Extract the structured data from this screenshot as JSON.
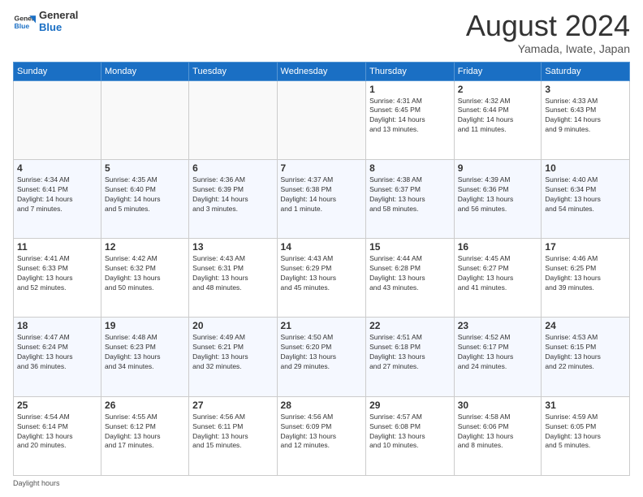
{
  "header": {
    "logo_line1": "General",
    "logo_line2": "Blue",
    "title": "August 2024",
    "location": "Yamada, Iwate, Japan"
  },
  "weekdays": [
    "Sunday",
    "Monday",
    "Tuesday",
    "Wednesday",
    "Thursday",
    "Friday",
    "Saturday"
  ],
  "weeks": [
    [
      {
        "day": "",
        "info": ""
      },
      {
        "day": "",
        "info": ""
      },
      {
        "day": "",
        "info": ""
      },
      {
        "day": "",
        "info": ""
      },
      {
        "day": "1",
        "info": "Sunrise: 4:31 AM\nSunset: 6:45 PM\nDaylight: 14 hours\nand 13 minutes."
      },
      {
        "day": "2",
        "info": "Sunrise: 4:32 AM\nSunset: 6:44 PM\nDaylight: 14 hours\nand 11 minutes."
      },
      {
        "day": "3",
        "info": "Sunrise: 4:33 AM\nSunset: 6:43 PM\nDaylight: 14 hours\nand 9 minutes."
      }
    ],
    [
      {
        "day": "4",
        "info": "Sunrise: 4:34 AM\nSunset: 6:41 PM\nDaylight: 14 hours\nand 7 minutes."
      },
      {
        "day": "5",
        "info": "Sunrise: 4:35 AM\nSunset: 6:40 PM\nDaylight: 14 hours\nand 5 minutes."
      },
      {
        "day": "6",
        "info": "Sunrise: 4:36 AM\nSunset: 6:39 PM\nDaylight: 14 hours\nand 3 minutes."
      },
      {
        "day": "7",
        "info": "Sunrise: 4:37 AM\nSunset: 6:38 PM\nDaylight: 14 hours\nand 1 minute."
      },
      {
        "day": "8",
        "info": "Sunrise: 4:38 AM\nSunset: 6:37 PM\nDaylight: 13 hours\nand 58 minutes."
      },
      {
        "day": "9",
        "info": "Sunrise: 4:39 AM\nSunset: 6:36 PM\nDaylight: 13 hours\nand 56 minutes."
      },
      {
        "day": "10",
        "info": "Sunrise: 4:40 AM\nSunset: 6:34 PM\nDaylight: 13 hours\nand 54 minutes."
      }
    ],
    [
      {
        "day": "11",
        "info": "Sunrise: 4:41 AM\nSunset: 6:33 PM\nDaylight: 13 hours\nand 52 minutes."
      },
      {
        "day": "12",
        "info": "Sunrise: 4:42 AM\nSunset: 6:32 PM\nDaylight: 13 hours\nand 50 minutes."
      },
      {
        "day": "13",
        "info": "Sunrise: 4:43 AM\nSunset: 6:31 PM\nDaylight: 13 hours\nand 48 minutes."
      },
      {
        "day": "14",
        "info": "Sunrise: 4:43 AM\nSunset: 6:29 PM\nDaylight: 13 hours\nand 45 minutes."
      },
      {
        "day": "15",
        "info": "Sunrise: 4:44 AM\nSunset: 6:28 PM\nDaylight: 13 hours\nand 43 minutes."
      },
      {
        "day": "16",
        "info": "Sunrise: 4:45 AM\nSunset: 6:27 PM\nDaylight: 13 hours\nand 41 minutes."
      },
      {
        "day": "17",
        "info": "Sunrise: 4:46 AM\nSunset: 6:25 PM\nDaylight: 13 hours\nand 39 minutes."
      }
    ],
    [
      {
        "day": "18",
        "info": "Sunrise: 4:47 AM\nSunset: 6:24 PM\nDaylight: 13 hours\nand 36 minutes."
      },
      {
        "day": "19",
        "info": "Sunrise: 4:48 AM\nSunset: 6:23 PM\nDaylight: 13 hours\nand 34 minutes."
      },
      {
        "day": "20",
        "info": "Sunrise: 4:49 AM\nSunset: 6:21 PM\nDaylight: 13 hours\nand 32 minutes."
      },
      {
        "day": "21",
        "info": "Sunrise: 4:50 AM\nSunset: 6:20 PM\nDaylight: 13 hours\nand 29 minutes."
      },
      {
        "day": "22",
        "info": "Sunrise: 4:51 AM\nSunset: 6:18 PM\nDaylight: 13 hours\nand 27 minutes."
      },
      {
        "day": "23",
        "info": "Sunrise: 4:52 AM\nSunset: 6:17 PM\nDaylight: 13 hours\nand 24 minutes."
      },
      {
        "day": "24",
        "info": "Sunrise: 4:53 AM\nSunset: 6:15 PM\nDaylight: 13 hours\nand 22 minutes."
      }
    ],
    [
      {
        "day": "25",
        "info": "Sunrise: 4:54 AM\nSunset: 6:14 PM\nDaylight: 13 hours\nand 20 minutes."
      },
      {
        "day": "26",
        "info": "Sunrise: 4:55 AM\nSunset: 6:12 PM\nDaylight: 13 hours\nand 17 minutes."
      },
      {
        "day": "27",
        "info": "Sunrise: 4:56 AM\nSunset: 6:11 PM\nDaylight: 13 hours\nand 15 minutes."
      },
      {
        "day": "28",
        "info": "Sunrise: 4:56 AM\nSunset: 6:09 PM\nDaylight: 13 hours\nand 12 minutes."
      },
      {
        "day": "29",
        "info": "Sunrise: 4:57 AM\nSunset: 6:08 PM\nDaylight: 13 hours\nand 10 minutes."
      },
      {
        "day": "30",
        "info": "Sunrise: 4:58 AM\nSunset: 6:06 PM\nDaylight: 13 hours\nand 8 minutes."
      },
      {
        "day": "31",
        "info": "Sunrise: 4:59 AM\nSunset: 6:05 PM\nDaylight: 13 hours\nand 5 minutes."
      }
    ]
  ],
  "footer": {
    "daylight_label": "Daylight hours"
  }
}
